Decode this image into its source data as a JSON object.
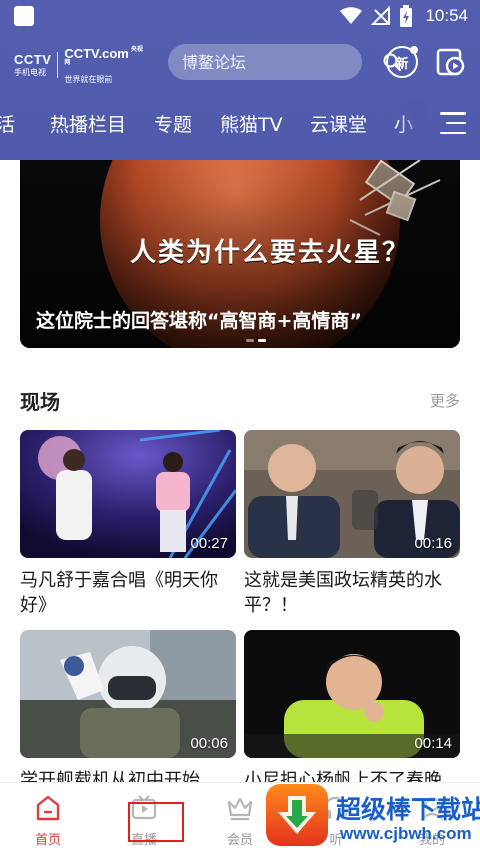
{
  "status_bar": {
    "time": "10:54"
  },
  "header": {
    "logo": {
      "brand_1": "CCTV",
      "brand_1_sub": "手机电视",
      "brand_2": "CCTV.com",
      "brand_2_tag": "央视网",
      "brand_2_sub": "世界就在眼前"
    },
    "search": {
      "placeholder": "博鳌论坛"
    },
    "new_label": "新"
  },
  "nav": {
    "tabs": [
      {
        "label": "活"
      },
      {
        "label": "热播栏目"
      },
      {
        "label": "专题"
      },
      {
        "label": "熊猫TV"
      },
      {
        "label": "云课堂"
      },
      {
        "label": "小"
      }
    ]
  },
  "banner": {
    "title": "人类为什么要去火星？",
    "caption": "这位院士的回答堪称“高智商+高情商”"
  },
  "section": {
    "title": "现场",
    "more": "更多",
    "cards": [
      {
        "title": "马凡舒于嘉合唱《明天你好》",
        "duration": "00:27"
      },
      {
        "title": "这就是美国政坛精英的水平？！",
        "duration": "00:16"
      },
      {
        "title": "学开舰载机从初中开始",
        "duration": "00:06"
      },
      {
        "title": "小尼担心杨帆上不了春晚",
        "duration": "00:14"
      }
    ]
  },
  "bottom_nav": {
    "items": [
      {
        "label": "首页",
        "icon": "home-icon"
      },
      {
        "label": "直播",
        "icon": "tv-icon"
      },
      {
        "label": "会员",
        "icon": "crown-icon"
      },
      {
        "label": "听",
        "icon": "headphones-icon"
      },
      {
        "label": "我的",
        "icon": "user-icon"
      }
    ]
  },
  "watermark": {
    "text": "超级棒下载站",
    "url": "www.cjbwh.com"
  },
  "colors": {
    "header_bg": "#545fb0",
    "accent_red": "#e03a3a",
    "watermark_blue": "#1a5fc8"
  }
}
